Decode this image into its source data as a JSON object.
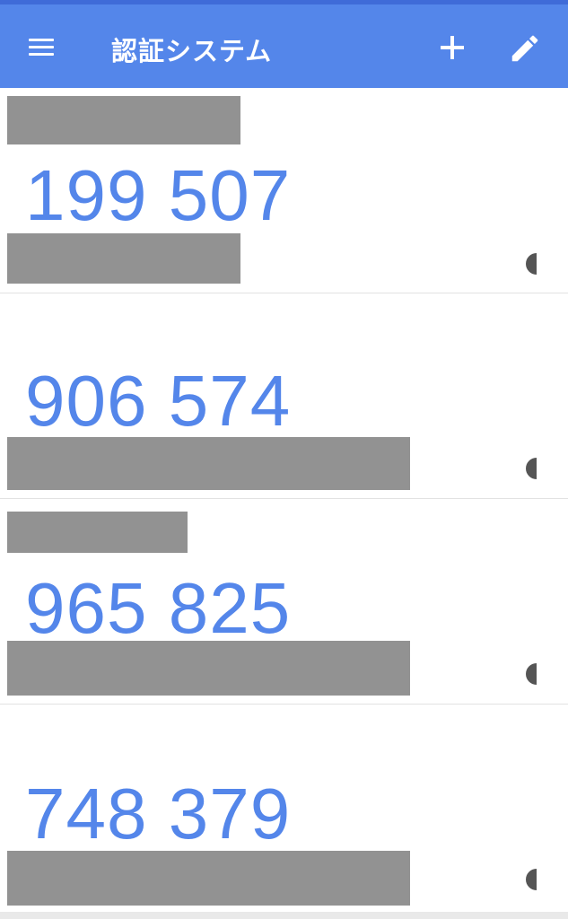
{
  "appbar": {
    "title": "認証システム",
    "menu_icon": "menu-icon",
    "add_icon": "plus-icon",
    "edit_icon": "pencil-icon",
    "color": "#5486ea"
  },
  "accounts": [
    {
      "code": "199 507",
      "issuer_redacted": true,
      "account_redacted": true
    },
    {
      "code": "906 574",
      "issuer_redacted": false,
      "account_redacted": true
    },
    {
      "code": "965 825",
      "issuer_redacted": true,
      "account_redacted": true
    },
    {
      "code": "748 379",
      "issuer_redacted": false,
      "account_redacted": true
    }
  ],
  "colors": {
    "code": "#5486ea",
    "redaction": "#929292",
    "timer": "#555555"
  }
}
